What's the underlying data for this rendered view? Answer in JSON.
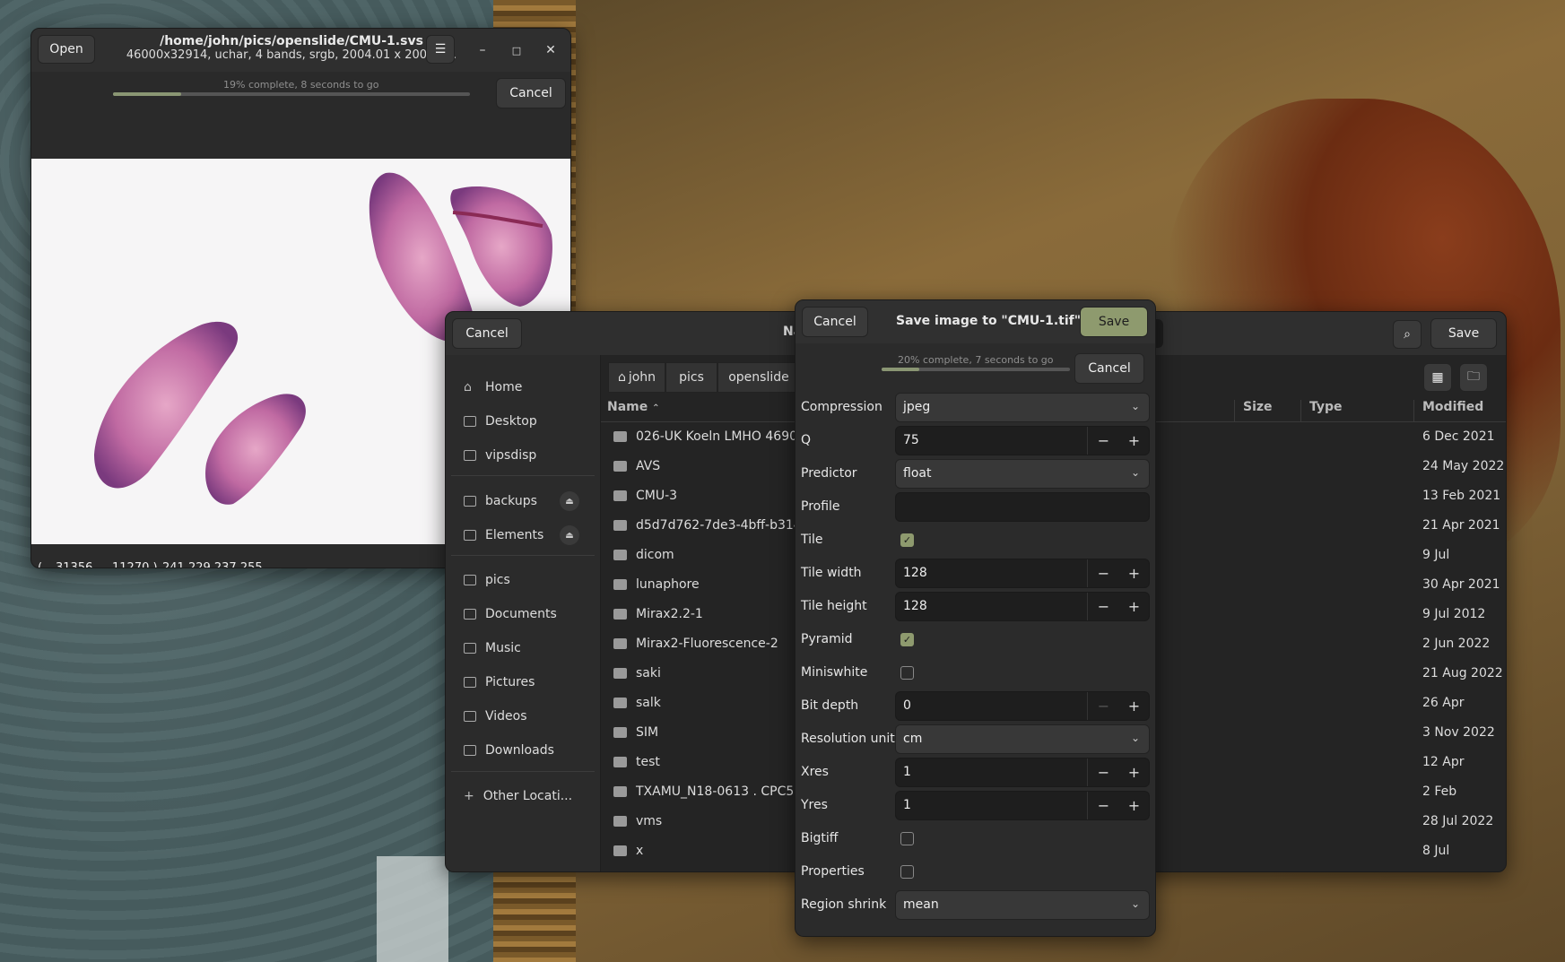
{
  "viewer": {
    "open_label": "Open",
    "title": "/home/john/pics/openslide/CMU-1.svs",
    "subtitle": "46000x32914,  uchar, 4 bands, srgb, 2004.01 x 2004.0...",
    "progress_text": "19% complete, 8 seconds to go",
    "progress": 0.19,
    "cancel_label": "Cancel",
    "status_x": "31356 ,",
    "status_y": "11270 )",
    "status_open": "(",
    "status_pixel": "241 229 237 255"
  },
  "chooser": {
    "cancel_label": "Cancel",
    "title_partial": "Na",
    "save_label": "Save",
    "sidebar": [
      {
        "label": "Home",
        "icon": "home-icon"
      },
      {
        "label": "Desktop",
        "icon": "desktop-icon"
      },
      {
        "label": "vipsdisp",
        "icon": "folder-icon"
      },
      {
        "label": "backups",
        "icon": "drive-icon"
      },
      {
        "label": "Elements",
        "icon": "drive-icon"
      },
      {
        "label": "pics",
        "icon": "folder-icon"
      },
      {
        "label": "Documents",
        "icon": "folder-icon"
      },
      {
        "label": "Music",
        "icon": "folder-icon"
      },
      {
        "label": "Pictures",
        "icon": "folder-icon"
      },
      {
        "label": "Videos",
        "icon": "folder-icon"
      },
      {
        "label": "Downloads",
        "icon": "folder-icon"
      },
      {
        "label": "Other Locati...",
        "icon": "plus-icon"
      }
    ],
    "breadcrumbs": [
      "john",
      "pics",
      "openslide"
    ],
    "columns": {
      "name": "Name",
      "size": "Size",
      "type": "Type",
      "modified": "Modified"
    },
    "files": [
      {
        "name": "026-UK Koeln LMHO 4690_1",
        "modified": "6 Dec 2021"
      },
      {
        "name": "AVS",
        "modified": "24 May 2022"
      },
      {
        "name": "CMU-3",
        "modified": "13 Feb 2021"
      },
      {
        "name": "d5d7d762-7de3-4bff-b314-e",
        "modified": "21 Apr 2021"
      },
      {
        "name": "dicom",
        "modified": "9 Jul"
      },
      {
        "name": "lunaphore",
        "modified": "30 Apr 2021"
      },
      {
        "name": "Mirax2.2-1",
        "modified": "9 Jul 2012"
      },
      {
        "name": "Mirax2-Fluorescence-2",
        "modified": "2 Jun 2022"
      },
      {
        "name": "saki",
        "modified": "21 Aug 2022"
      },
      {
        "name": "salk",
        "modified": "26 Apr"
      },
      {
        "name": "SIM",
        "modified": "3 Nov 2022"
      },
      {
        "name": "test",
        "modified": "12 Apr"
      },
      {
        "name": "TXAMU_N18-0613 . CPC516",
        "modified": "2 Feb"
      },
      {
        "name": "vms",
        "modified": "28 Jul 2022"
      },
      {
        "name": "x",
        "modified": "8 Jul"
      }
    ]
  },
  "save_dialog": {
    "cancel_label": "Cancel",
    "title": "Save image to \"CMU-1.tif\"",
    "save_label": "Save",
    "progress_text": "20% complete, 7 seconds to go",
    "progress": 0.2,
    "progress_cancel": "Cancel",
    "options": {
      "compression": {
        "label": "Compression",
        "value": "jpeg"
      },
      "q": {
        "label": "Q",
        "value": "75"
      },
      "predictor": {
        "label": "Predictor",
        "value": "float"
      },
      "profile": {
        "label": "Profile",
        "value": ""
      },
      "tile": {
        "label": "Tile",
        "checked": true
      },
      "tile_width": {
        "label": "Tile width",
        "value": "128"
      },
      "tile_height": {
        "label": "Tile height",
        "value": "128"
      },
      "pyramid": {
        "label": "Pyramid",
        "checked": true
      },
      "miniswhite": {
        "label": "Miniswhite",
        "checked": false
      },
      "bit_depth": {
        "label": "Bit depth",
        "value": "0"
      },
      "resolution_unit": {
        "label": "Resolution unit",
        "value": "cm"
      },
      "xres": {
        "label": "Xres",
        "value": "1"
      },
      "yres": {
        "label": "Yres",
        "value": "1"
      },
      "bigtiff": {
        "label": "Bigtiff",
        "checked": false
      },
      "properties": {
        "label": "Properties",
        "checked": false
      },
      "region_shrink": {
        "label": "Region shrink",
        "value": "mean"
      }
    }
  },
  "colors": {
    "accent": "#8e9a6e",
    "window_bg": "#2b2b2b"
  }
}
